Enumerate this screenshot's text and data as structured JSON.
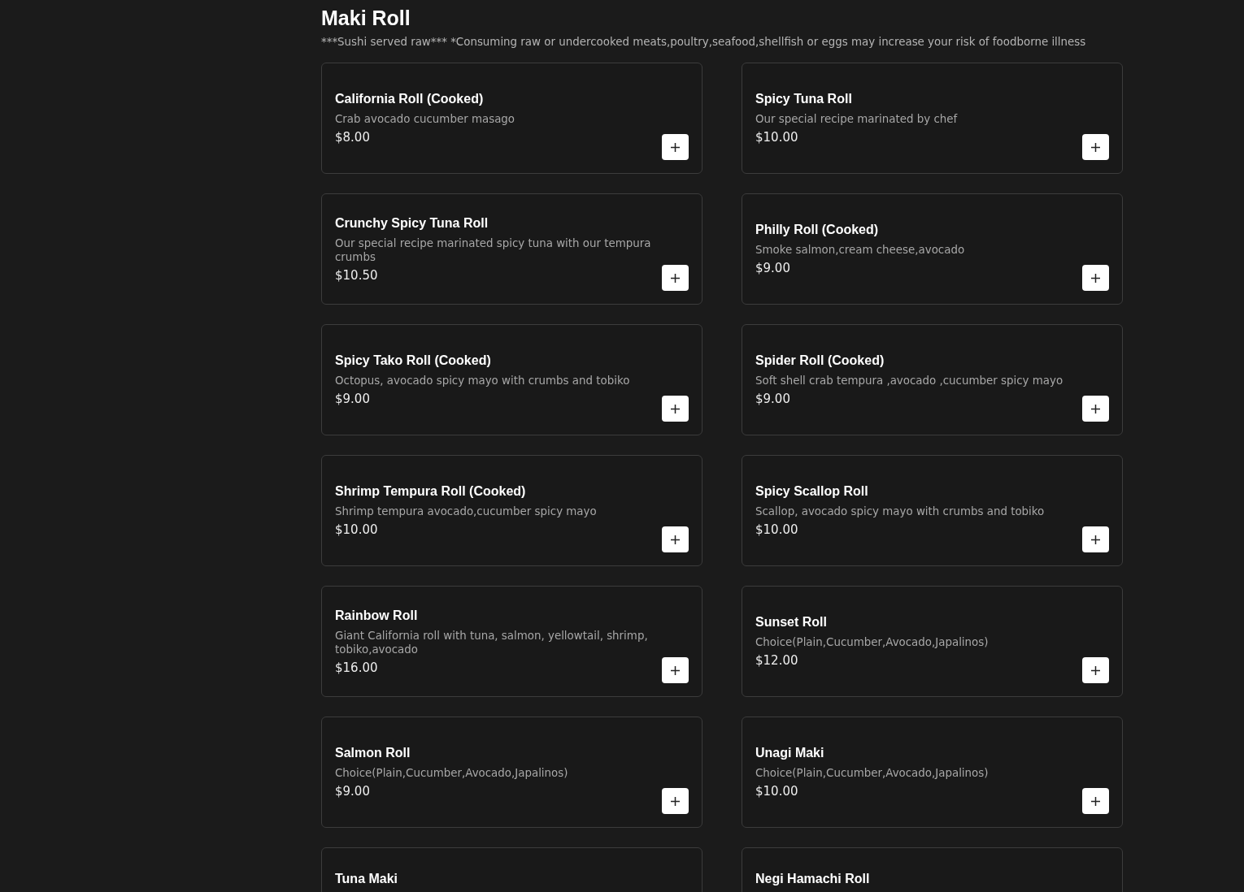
{
  "section": {
    "title": "Maki Roll",
    "note": "***Sushi served raw*** *Consuming raw or undercooked meats,poultry,seafood,shellfish or eggs may increase your risk of foodborne illness"
  },
  "items": [
    {
      "name": "California Roll (Cooked)",
      "description": "Crab avocado cucumber masago",
      "price": "$8.00"
    },
    {
      "name": "Spicy Tuna Roll",
      "description": "Our special recipe marinated by chef",
      "price": "$10.00"
    },
    {
      "name": "Crunchy Spicy Tuna Roll",
      "description": "Our special recipe marinated spicy tuna with our tempura crumbs",
      "price": "$10.50"
    },
    {
      "name": "Philly Roll (Cooked)",
      "description": "Smoke salmon,cream cheese,avocado",
      "price": "$9.00"
    },
    {
      "name": "Spicy Tako Roll (Cooked)",
      "description": "Octopus, avocado spicy mayo with crumbs and tobiko",
      "price": "$9.00"
    },
    {
      "name": "Spider Roll (Cooked)",
      "description": "Soft shell crab tempura ,avocado ,cucumber spicy mayo",
      "price": "$9.00"
    },
    {
      "name": "Shrimp Tempura Roll (Cooked)",
      "description": "Shrimp tempura avocado,cucumber spicy mayo",
      "price": "$10.00"
    },
    {
      "name": "Spicy Scallop Roll",
      "description": "Scallop, avocado spicy mayo with crumbs and tobiko",
      "price": "$10.00"
    },
    {
      "name": "Rainbow Roll",
      "description": "Giant California roll with tuna, salmon, yellowtail, shrimp, tobiko,avocado",
      "price": "$16.00"
    },
    {
      "name": "Sunset Roll",
      "description": "Choice(Plain,Cucumber,Avocado,Japalinos)",
      "price": "$12.00"
    },
    {
      "name": "Salmon Roll",
      "description": "Choice(Plain,Cucumber,Avocado,Japalinos)",
      "price": "$9.00"
    },
    {
      "name": "Unagi Maki",
      "description": "Choice(Plain,Cucumber,Avocado,Japalinos)",
      "price": "$10.00"
    },
    {
      "name": "Tuna Maki"
    },
    {
      "name": "Negi Hamachi Roll"
    }
  ]
}
